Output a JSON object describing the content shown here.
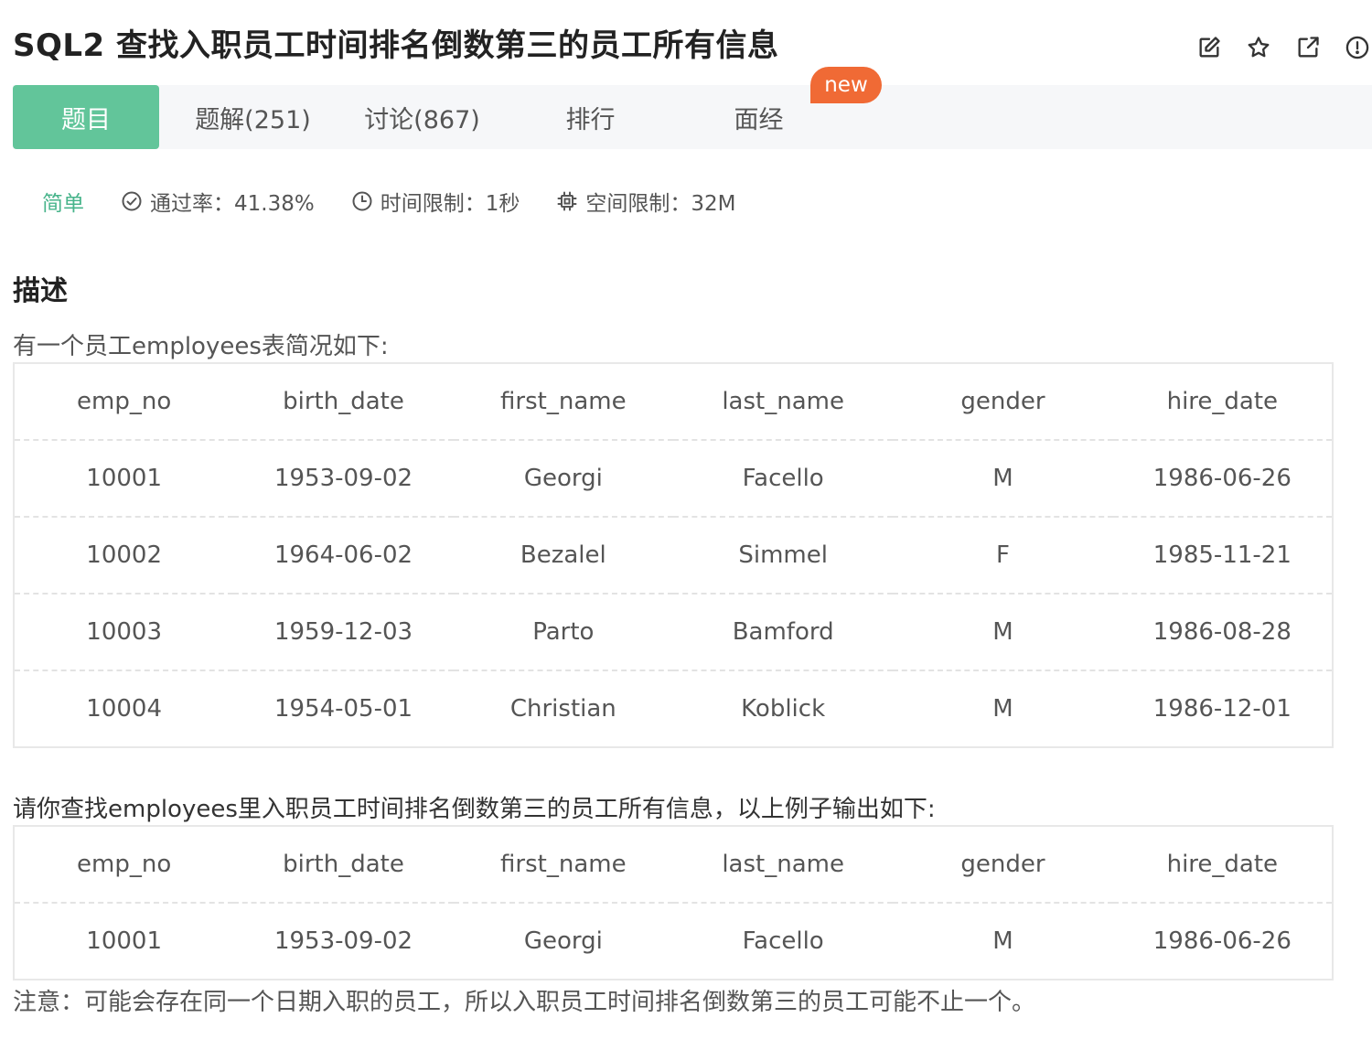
{
  "header": {
    "title": "SQL2  查找入职员工时间排名倒数第三的员工所有信息",
    "actions": [
      {
        "name": "edit-icon"
      },
      {
        "name": "star-icon"
      },
      {
        "name": "share-icon"
      },
      {
        "name": "info-icon"
      }
    ]
  },
  "tabs": {
    "items": [
      "题目",
      "题解(251)",
      "讨论(867)",
      "排行",
      "面经"
    ],
    "active_index": 0,
    "badge": "new"
  },
  "meta": {
    "difficulty": "简单",
    "pass_rate": "通过率：41.38%",
    "time_limit": "时间限制：1秒",
    "space_limit": "空间限制：32M"
  },
  "description": {
    "heading": "描述",
    "intro": "有一个员工employees表简况如下:",
    "columns": [
      "emp_no",
      "birth_date",
      "first_name",
      "last_name",
      "gender",
      "hire_date"
    ],
    "rows": [
      [
        "10001",
        "1953-09-02",
        "Georgi",
        "Facello",
        "M",
        "1986-06-26"
      ],
      [
        "10002",
        "1964-06-02",
        "Bezalel",
        "Simmel",
        "F",
        "1985-11-21"
      ],
      [
        "10003",
        "1959-12-03",
        "Parto",
        "Bamford",
        "M",
        "1986-08-28"
      ],
      [
        "10004",
        "1954-05-01",
        "Christian",
        "Koblick",
        "M",
        "1986-12-01"
      ]
    ],
    "task": "请你查找employees里入职员工时间排名倒数第三的员工所有信息，以上例子输出如下:",
    "result_columns": [
      "emp_no",
      "birth_date",
      "first_name",
      "last_name",
      "gender",
      "hire_date"
    ],
    "result_rows": [
      [
        "10001",
        "1953-09-02",
        "Georgi",
        "Facello",
        "M",
        "1986-06-26"
      ]
    ],
    "note": "注意：可能会存在同一个日期入职的员工，所以入职员工时间排名倒数第三的员工可能不止一个。"
  },
  "colors": {
    "accent": "#62c59a",
    "difficulty": "#48b48b",
    "badge": "#f06a35"
  }
}
